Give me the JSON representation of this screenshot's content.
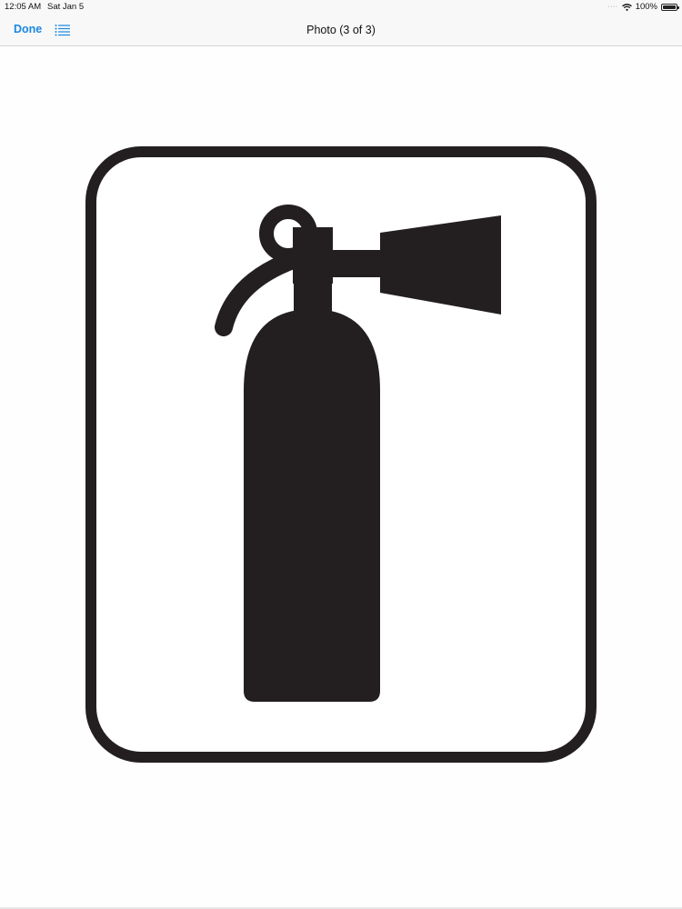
{
  "status_bar": {
    "time": "12:05 AM",
    "date": "Sat Jan 5",
    "battery": "100%",
    "wifi_icon": "wifi-icon",
    "battery_icon": "battery-icon"
  },
  "nav": {
    "done_label": "Done",
    "list_icon": "list-icon",
    "title": "Photo (3 of 3)"
  },
  "photo": {
    "subject_icon": "fire-extinguisher-icon",
    "symbol_color": "#231f20",
    "background_color": "#ffffff"
  },
  "colors": {
    "accent": "#1a87e0",
    "bar_background": "#f8f8f8"
  }
}
